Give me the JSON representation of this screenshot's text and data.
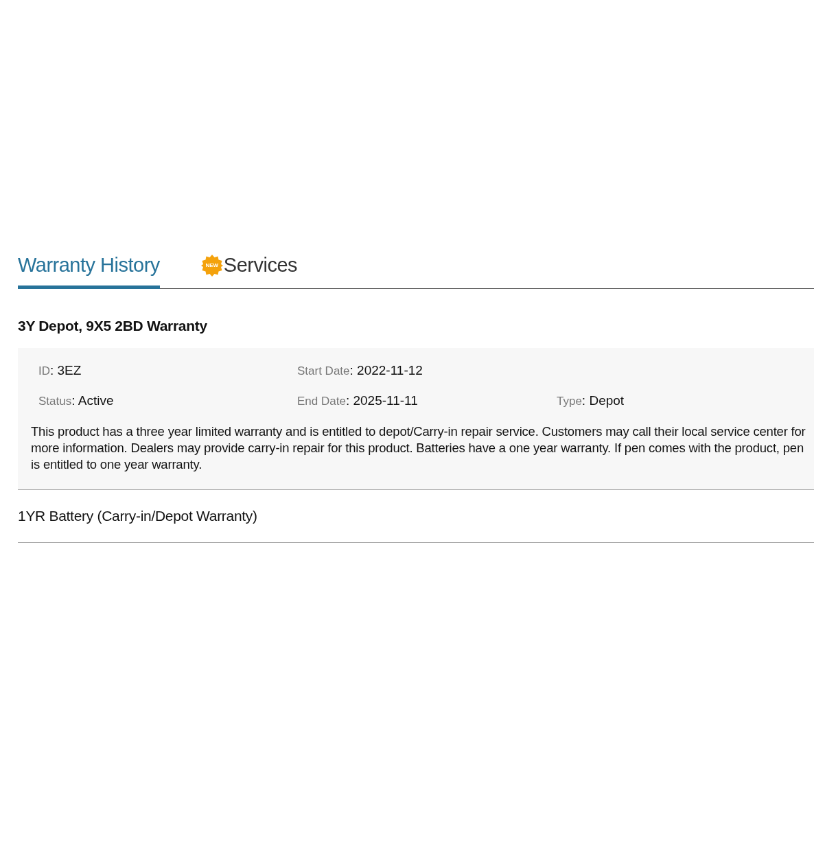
{
  "tabs": [
    {
      "label": "Warranty History",
      "selected": true
    },
    {
      "label": "Services",
      "selected": false,
      "badge": "NEW"
    }
  ],
  "warranties": [
    {
      "title": "3Y Depot, 9X5 2BD Warranty",
      "expanded": true,
      "field_rows": [
        [
          {
            "label": "ID",
            "value": ": 3EZ"
          },
          {
            "label": "Start Date",
            "value": ": 2022-11-12"
          }
        ],
        [
          {
            "label": "Status",
            "value": ": Active"
          },
          {
            "label": "End Date",
            "value": ": 2025-11-11"
          },
          {
            "label": "Type",
            "value": ": Depot"
          }
        ]
      ],
      "description": "This product has a three year limited warranty and is entitled to depot/Carry-in repair service. Customers may call their local service center for more information. Dealers may provide carry-in repair for this product. Batteries have a one year warranty. If pen comes with the product, pen is entitled to one year warranty."
    },
    {
      "title": "1YR Battery (Carry-in/Depot Warranty)",
      "expanded": false
    }
  ]
}
